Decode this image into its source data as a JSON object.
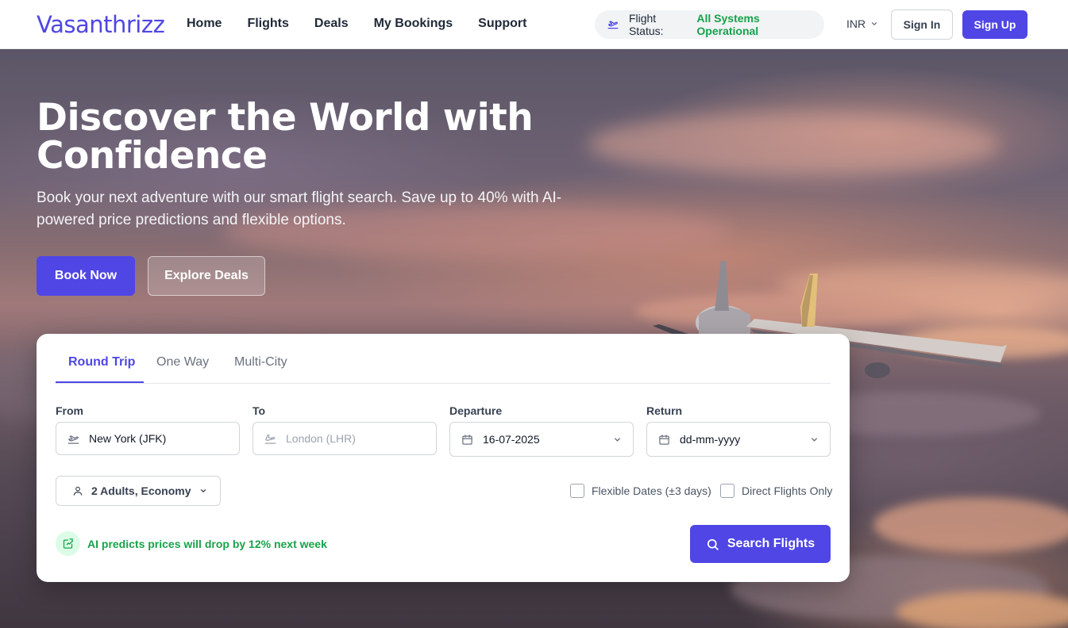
{
  "nav": {
    "brand": "Vasanthrizz",
    "links": [
      "Home",
      "Flights",
      "Deals",
      "My Bookings",
      "Support"
    ],
    "status_label": "Flight Status:",
    "status_value": "All Systems Operational",
    "currency": "INR",
    "sign_in": "Sign In",
    "sign_up": "Sign Up"
  },
  "hero": {
    "title": "Discover the World with Confidence",
    "subtitle": "Book your next adventure with our smart flight search. Save up to 40% with AI-powered price predictions and flexible options.",
    "book_now": "Book Now",
    "explore_deals": "Explore Deals"
  },
  "search": {
    "tabs": [
      "Round Trip",
      "One Way",
      "Multi-City"
    ],
    "active_tab": "Round Trip",
    "from_label": "From",
    "from_value": "New York (JFK)",
    "to_label": "To",
    "to_placeholder": "London (LHR)",
    "departure_label": "Departure",
    "departure_value": "16-07-2025",
    "return_label": "Return",
    "return_placeholder": "dd-mm-yyyy",
    "passengers": "2 Adults, Economy",
    "flexible_dates": "Flexible Dates (±3 days)",
    "direct_only": "Direct Flights Only",
    "ai_note": "AI predicts prices will drop by 12% next week",
    "search_button": "Search Flights"
  },
  "colors": {
    "accent": "#4f46e5",
    "success": "#16a34a"
  },
  "icons": {
    "status": "plane-departure-icon",
    "from": "plane-takeoff-icon",
    "to": "plane-landing-icon",
    "date": "calendar-icon",
    "passenger": "user-icon",
    "ai": "trend-icon",
    "search": "search-icon"
  }
}
